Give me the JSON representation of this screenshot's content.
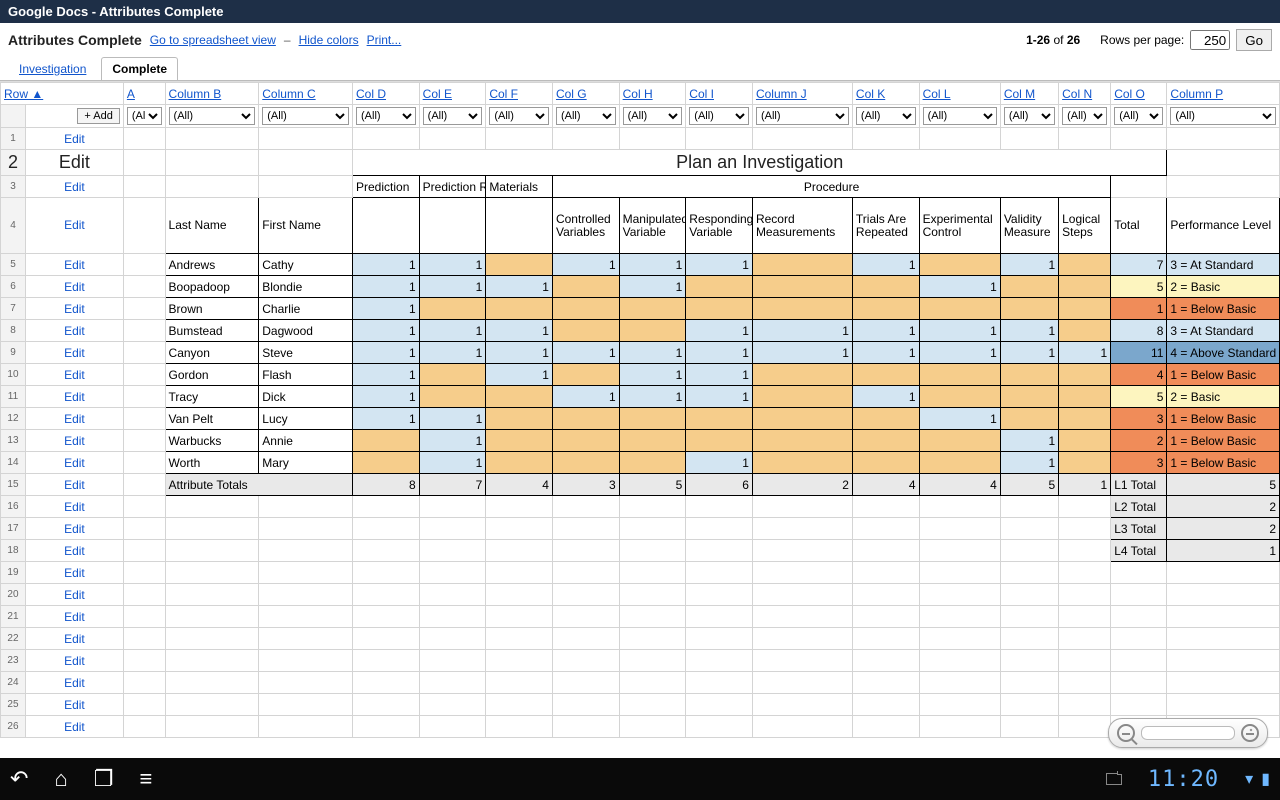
{
  "window_title": "Google Docs - Attributes Complete",
  "doc_name": "Attributes Complete",
  "links": {
    "spreadsheet_view": "Go to spreadsheet view",
    "hide_colors": "Hide colors",
    "print": "Print..."
  },
  "paging": {
    "range": "1-26",
    "of_word": "of",
    "total": "26",
    "rpp_label": "Rows per page:",
    "rpp_value": "250",
    "go": "Go"
  },
  "tabs": {
    "investigation": "Investigation",
    "complete": "Complete"
  },
  "columns": {
    "row": "Row ▲",
    "A": "A",
    "B": "Column B",
    "C": "Column C",
    "D": "Col D",
    "E": "Col E",
    "F": "Col F",
    "G": "Col G",
    "H": "Col H",
    "I": "Col I",
    "J": "Column J",
    "K": "Col K",
    "L": "Col L",
    "M": "Col M",
    "N": "Col N",
    "O": "Col O",
    "P": "Column P"
  },
  "add_btn": "+ Add",
  "filter_all": "(All)",
  "edit": "Edit",
  "big_title": "Plan an Investigation",
  "hdr": {
    "prediction": "Prediction",
    "reason": "Prediction Reason",
    "materials": "Materials",
    "procedure": "Procedure",
    "last": "Last Name",
    "first": "First Name",
    "cv": "Controlled Variables",
    "mv": "Manipulated Variable",
    "rv": "Responding Variable",
    "rm": "Record Measurements",
    "tr": "Trials Are Repeated",
    "ec": "Experimental Control",
    "vm": "Validity Measure",
    "ls": "Logical Steps",
    "total": "Total",
    "perf": "Performance Level"
  },
  "rows": [
    {
      "last": "Andrews",
      "first": "Cathy",
      "d": "1",
      "e": "1",
      "f": "",
      "g": "1",
      "h": "1",
      "i": "1",
      "j": "",
      "k": "1",
      "l": "",
      "m": "1",
      "n": "",
      "o": "7",
      "p": "3 = At Standard",
      "pc": "c-blue"
    },
    {
      "last": "Boopadoop",
      "first": "Blondie",
      "d": "1",
      "e": "1",
      "f": "1",
      "g": "",
      "h": "1",
      "i": "",
      "j": "",
      "k": "",
      "l": "1",
      "m": "",
      "n": "",
      "o": "5",
      "p": "2 = Basic",
      "pc": "c-yel"
    },
    {
      "last": "Brown",
      "first": "Charlie",
      "d": "1",
      "e": "",
      "f": "",
      "g": "",
      "h": "",
      "i": "",
      "j": "",
      "k": "",
      "l": "",
      "m": "",
      "n": "",
      "o": "1",
      "p": "1 = Below Basic",
      "pc": "c-red"
    },
    {
      "last": "Bumstead",
      "first": "Dagwood",
      "d": "1",
      "e": "1",
      "f": "1",
      "g": "",
      "h": "",
      "i": "1",
      "j": "1",
      "k": "1",
      "l": "1",
      "m": "1",
      "n": "",
      "o": "8",
      "p": "3 = At Standard",
      "pc": "c-blue"
    },
    {
      "last": "Canyon",
      "first": "Steve",
      "d": "1",
      "e": "1",
      "f": "1",
      "g": "1",
      "h": "1",
      "i": "1",
      "j": "1",
      "k": "1",
      "l": "1",
      "m": "1",
      "n": "1",
      "o": "11",
      "p": "4 = Above Standard",
      "pc": "c-bluD"
    },
    {
      "last": "Gordon",
      "first": "Flash",
      "d": "1",
      "e": "",
      "f": "1",
      "g": "",
      "h": "1",
      "i": "1",
      "j": "",
      "k": "",
      "l": "",
      "m": "",
      "n": "",
      "o": "4",
      "p": "1 = Below Basic",
      "pc": "c-red"
    },
    {
      "last": "Tracy",
      "first": "Dick",
      "d": "1",
      "e": "",
      "f": "",
      "g": "1",
      "h": "1",
      "i": "1",
      "j": "",
      "k": "1",
      "l": "",
      "m": "",
      "n": "",
      "o": "5",
      "p": "2 = Basic",
      "pc": "c-yel"
    },
    {
      "last": "Van Pelt",
      "first": "Lucy",
      "d": "1",
      "e": "1",
      "f": "",
      "g": "",
      "h": "",
      "i": "",
      "j": "",
      "k": "",
      "l": "1",
      "m": "",
      "n": "",
      "o": "3",
      "p": "1 = Below Basic",
      "pc": "c-red"
    },
    {
      "last": "Warbucks",
      "first": "Annie",
      "d": "",
      "e": "1",
      "f": "",
      "g": "",
      "h": "",
      "i": "",
      "j": "",
      "k": "",
      "l": "",
      "m": "1",
      "n": "",
      "o": "2",
      "p": "1 = Below Basic",
      "pc": "c-red"
    },
    {
      "last": "Worth",
      "first": "Mary",
      "d": "",
      "e": "1",
      "f": "",
      "g": "",
      "h": "",
      "i": "1",
      "j": "",
      "k": "",
      "l": "",
      "m": "1",
      "n": "",
      "o": "3",
      "p": "1 = Below Basic",
      "pc": "c-red"
    }
  ],
  "totals": {
    "label": "Attribute Totals",
    "d": "8",
    "e": "7",
    "f": "4",
    "g": "3",
    "h": "5",
    "i": "6",
    "j": "2",
    "k": "4",
    "l": "4",
    "m": "5",
    "n": "1"
  },
  "ltotals": [
    {
      "label": "L1 Total",
      "val": "5"
    },
    {
      "label": "L2 Total",
      "val": "2"
    },
    {
      "label": "L3 Total",
      "val": "2"
    },
    {
      "label": "L4 Total",
      "val": "1"
    }
  ],
  "clock": "11:20"
}
